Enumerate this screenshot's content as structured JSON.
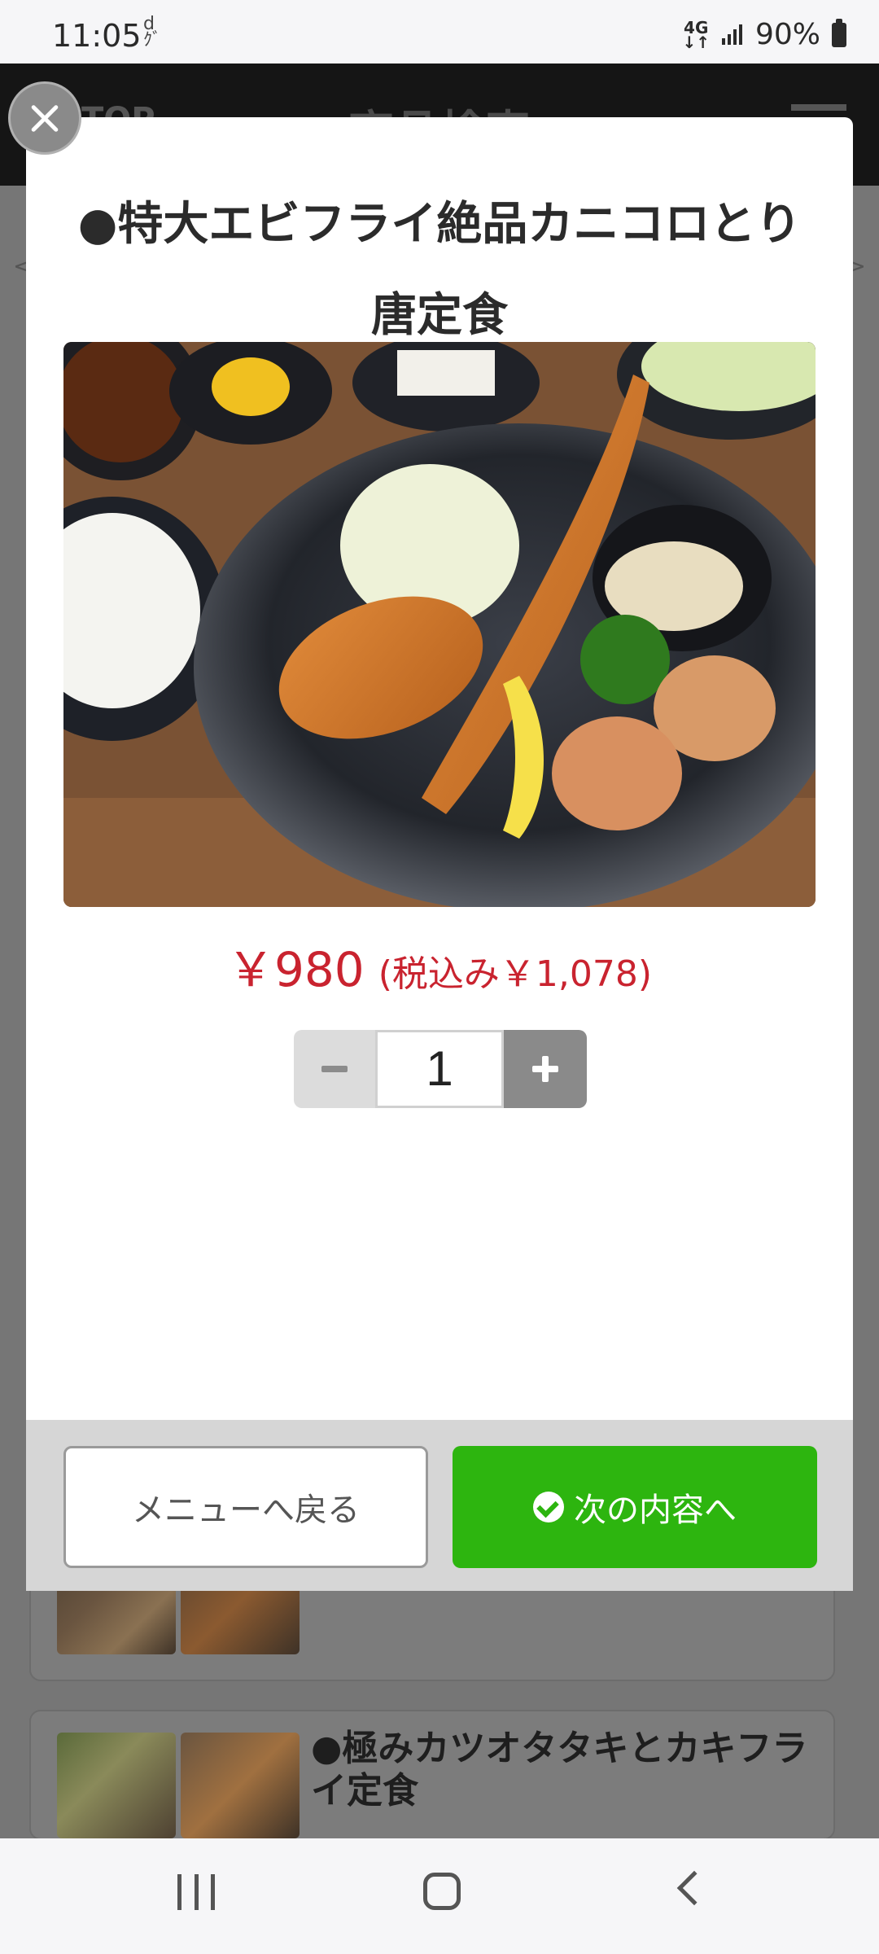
{
  "status_bar": {
    "time": "11:05",
    "network": "4G",
    "battery": "90%",
    "d_icon": "d"
  },
  "background_page": {
    "header_left": "TOP",
    "header_title": "商品検索",
    "item2_name": "●極みカツオタタキとカキフライ定食"
  },
  "modal": {
    "title": "●特大エビフライ絶品カニコロとり唐定食",
    "price": "￥980",
    "price_tax": "(税込み￥1,078)",
    "quantity": "1",
    "back_button": "メニューへ戻る",
    "next_button": "次の内容へ"
  },
  "colors": {
    "accent_green": "#2db50f",
    "price_red": "#c9232f"
  },
  "icons": [
    "close-icon",
    "minus-icon",
    "plus-icon",
    "check-circle-icon",
    "menu-icon",
    "signal-icon",
    "battery-icon"
  ]
}
